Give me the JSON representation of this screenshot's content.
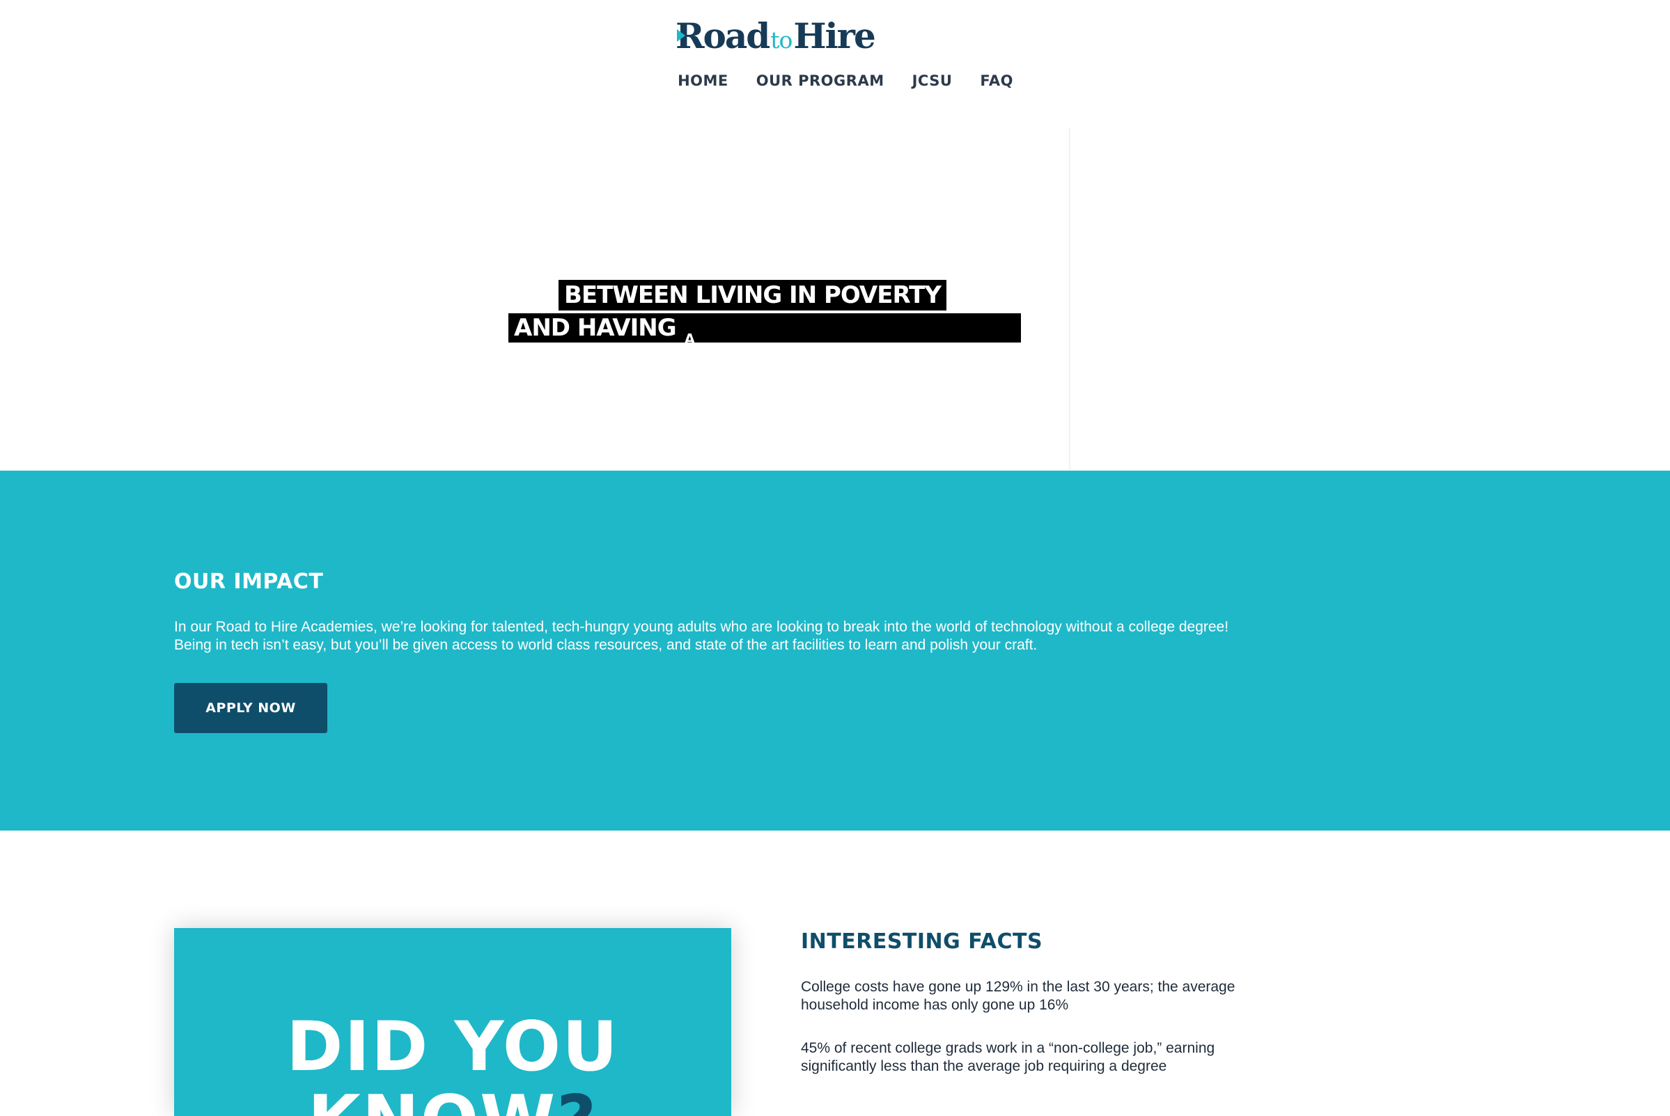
{
  "brand": {
    "logo_part1": "Road",
    "logo_part2": "to",
    "logo_part3": "Hire",
    "colors": {
      "teal": "#1fb8c8",
      "navy": "#0f4e6a",
      "dark_text": "#2d3a4a"
    }
  },
  "nav": {
    "items": [
      {
        "label": "HOME"
      },
      {
        "label": "OUR PROGRAM"
      },
      {
        "label": "JCSU"
      },
      {
        "label": "FAQ"
      }
    ]
  },
  "hero": {
    "line1": "BETWEEN LIVING IN POVERTY",
    "line2": "AND HAVING",
    "line2_partial": "A"
  },
  "impact": {
    "title": "OUR IMPACT",
    "text_line1": "In our Road to Hire Academies, we’re looking for talented, tech-hungry young adults who are looking to break into the world of technology without a college degree!",
    "text_line2": "Being in tech isn’t easy, but you’ll be given access to world class resources, and state of the art facilities to learn and polish your craft.",
    "button_label": "APPLY NOW"
  },
  "facts": {
    "card_line1": "DID YOU",
    "card_line2": "KNOW",
    "card_qmark": "?",
    "title": "INTERESTING FACTS",
    "items": [
      {
        "line1": "College costs have gone up 129% in the last 30 years; the average",
        "line2": "household income has only gone up 16%"
      },
      {
        "line1": "45% of recent college grads work in a “non-college job,” earning",
        "line2": "significantly less than the average job requiring a degree"
      }
    ]
  }
}
